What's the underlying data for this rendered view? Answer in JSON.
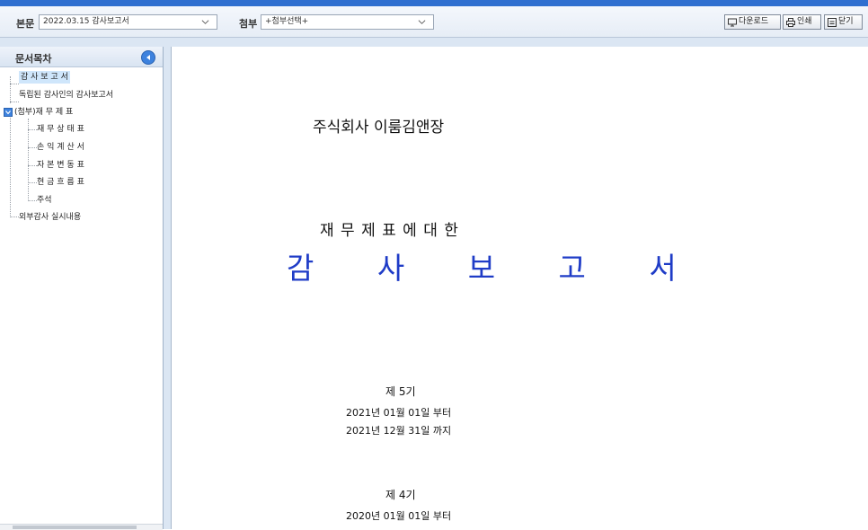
{
  "toolbar": {
    "body_label": "본문",
    "body_select": "2022.03.15  감사보고서",
    "attach_label": "첨부",
    "attach_select": "+첨부선택+",
    "download_label": "다운로드",
    "print_label": "인쇄",
    "close_label": "닫기"
  },
  "sidebar": {
    "title": "문서목차",
    "items": [
      "감 사 보 고 서",
      "독립된 감사인의 감사보고서",
      "(첨부)재 무 제 표",
      "재 무 상 태 표",
      "손 익 계 산 서",
      "자 본 변 동 표",
      "현 금 흐 름 표",
      "주석",
      "외부감사 실시내용"
    ]
  },
  "document": {
    "company": "주식회사 이룸김앤장",
    "subtitle": "재 무 제 표 에 대 한",
    "title": "감 사 보 고 서",
    "periods": [
      {
        "label": "제 5기",
        "from": "2021년 01월 01일  부터",
        "to": "2021년 12월 31일  까지"
      },
      {
        "label": "제 4기",
        "from": "2020년 01월 01일  부터"
      }
    ]
  },
  "colors": {
    "accent": "#3d82de",
    "title": "#1f3cc7",
    "selected": "#cfe6fb"
  }
}
